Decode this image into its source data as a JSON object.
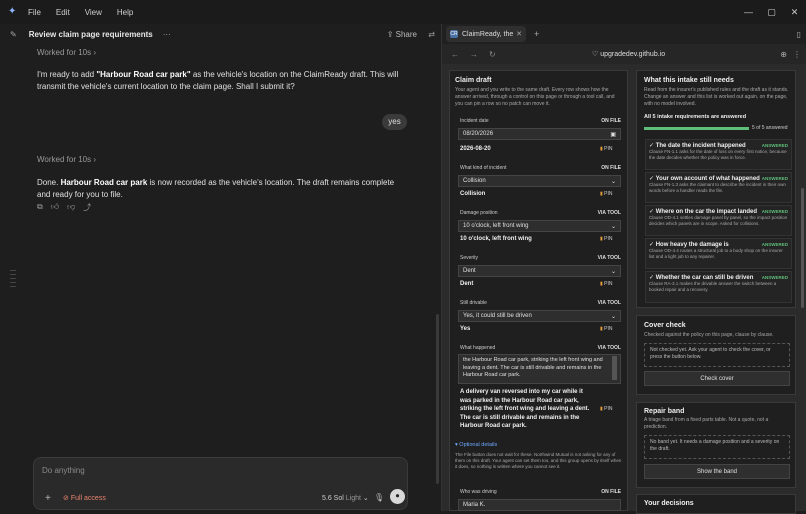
{
  "menu": {
    "items": [
      "File",
      "Edit",
      "View",
      "Help"
    ]
  },
  "window": {
    "minimize": "—",
    "maximize": "▢",
    "close": "✕"
  },
  "chat": {
    "title": "Review claim page requirements",
    "more": "···",
    "share": "Share",
    "worked1": "Worked for 10s",
    "msg1_pre": "I'm ready to add ",
    "msg1_bold": "\"Harbour Road car park\"",
    "msg1_post": " as the vehicle's location on the ClaimReady draft. This will transmit the vehicle's current location to the claim page. Shall I submit it?",
    "user_reply": "yes",
    "worked2": "Worked for 10s",
    "msg2_pre": "Done. ",
    "msg2_bold": "Harbour Road car park",
    "msg2_post": " is now recorded as the vehicle's location. The draft remains complete and ready for you to file.",
    "composer_placeholder": "Do anything",
    "access": "Full access",
    "model": "5.6 Sol",
    "mode": "Light"
  },
  "browser": {
    "tab_title": "ClaimReady, the",
    "tab_favicon": "CR",
    "url": "upgradedev.github.io"
  },
  "claim": {
    "title": "Claim draft",
    "desc": "Your agent and you write to the same draft. Every row shows how the answer arrived, through a control on this page or through a tool call, and you can pin a row so no patch can move it.",
    "fields": [
      {
        "label": "Incident date",
        "tag": "ON FILE",
        "input": "08/20/2026",
        "value": "2026-08-20",
        "pin": "PIN"
      },
      {
        "label": "What kind of incident",
        "tag": "ON FILE",
        "input": "Collision",
        "value": "Collision",
        "pin": "PIN"
      },
      {
        "label": "Damage position",
        "tag": "VIA TOOL",
        "input": "10 o'clock, left front wing",
        "value": "10 o'clock, left front wing",
        "pin": "PIN"
      },
      {
        "label": "Severity",
        "tag": "VIA TOOL",
        "input": "Dent",
        "value": "Dent",
        "pin": "PIN"
      },
      {
        "label": "Still drivable",
        "tag": "VIA TOOL",
        "input": "Yes, it could still be driven",
        "value": "Yes",
        "pin": "PIN"
      }
    ],
    "happened": {
      "label": "What happened",
      "tag": "VIA TOOL",
      "textarea": "the Harbour Road car park, striking the left front wing and leaving a dent. The car is still drivable and remains in the Harbour Road car park.",
      "value": "A delivery van reversed into my car while it was parked in the Harbour Road car park, striking the left front wing and leaving a dent. The car is still drivable and remains in the Harbour Road car park.",
      "pin": "PIN"
    },
    "optional_title": "▾ Optional details",
    "optional_desc": "The File button does not wait for these. Northwind Mutual is not asking for any of them on this draft. Your agent can set them too, and this group opens by itself when it does, so nothing is written where you cannot see it.",
    "driver": {
      "label": "Who was driving",
      "tag": "ON FILE",
      "input": "Maria K."
    }
  },
  "intake": {
    "title": "What this intake still needs",
    "desc": "Read from the insurer's published rules and the draft as it stands. Change an answer and this list is worked out again, on the page, with no model involved.",
    "summary": "All 5 intake requirements are answered",
    "progress": 1.0,
    "count": "5 of 5 answered",
    "items": [
      {
        "title": "The date the incident happened",
        "status": "ANSWERED",
        "desc": "Clause FN-1.1 asks for the date of loss on every first notice, because the date decides whether the policy was in force."
      },
      {
        "title": "Your own account of what happened",
        "status": "ANSWERED",
        "desc": "Clause FN-1.3 asks the claimant to describe the incident in their own words before a handler reads the file."
      },
      {
        "title": "Where on the car the impact landed",
        "status": "ANSWERED",
        "desc": "Clause OD-4.1 settles damage panel by panel, so the impact position decides which panels are in scope. Asked for collisions."
      },
      {
        "title": "How heavy the damage is",
        "status": "ANSWERED",
        "desc": "Clause OD-4.4 routes a structural job to a body shop on the insurer list and a light job to any repairer."
      },
      {
        "title": "Whether the car can still be driven",
        "status": "ANSWERED",
        "desc": "Clause RA-3.1 makes the drivable answer the switch between a booked repair and a recovery."
      }
    ]
  },
  "cover": {
    "title": "Cover check",
    "desc": "Checked against the policy on this page, clause by clause.",
    "note": "Not checked yet. Ask your agent to check the cover, or press the button below.",
    "button": "Check cover"
  },
  "repair": {
    "title": "Repair band",
    "desc": "A triage band from a fixed parts table. Not a quote, not a prediction.",
    "note": "No band yet. It needs a damage position and a severity on the draft.",
    "button": "Show the band"
  },
  "decisions": {
    "title": "Your decisions"
  },
  "colors": {
    "accent": "#5fbf7a",
    "pin": "#e8a03a",
    "access": "#e8846e"
  }
}
